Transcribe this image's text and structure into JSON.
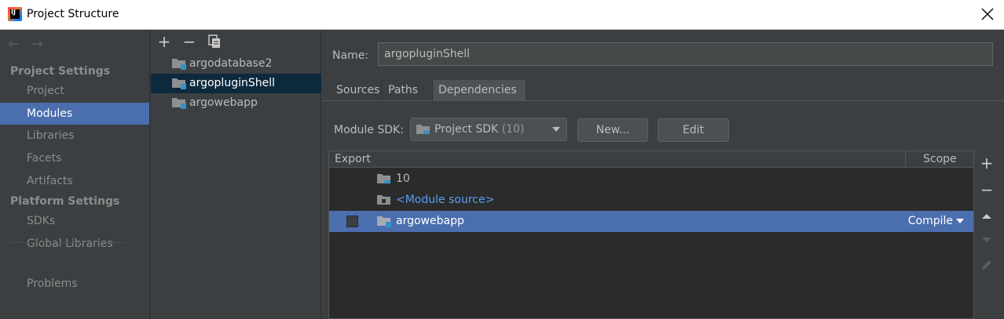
{
  "window": {
    "title": "Project Structure",
    "close_icon": "close-icon"
  },
  "nav": {
    "back_icon": "arrow-left-icon",
    "forward_icon": "arrow-right-icon",
    "project_settings_title": "Project Settings",
    "platform_settings_title": "Platform Settings",
    "items": {
      "project": "Project",
      "modules": "Modules",
      "libraries": "Libraries",
      "facets": "Facets",
      "artifacts": "Artifacts",
      "sdks": "SDKs",
      "global_libraries": "Global Libraries",
      "problems": "Problems"
    },
    "selected": "Modules"
  },
  "module_tree": {
    "toolbar": {
      "add": "+",
      "remove": "−",
      "copy_icon": "copy-icon"
    },
    "modules": [
      "argodatabase2",
      "argopluginShell",
      "argowebapp"
    ],
    "selected": "argopluginShell"
  },
  "module_detail": {
    "name_label": "Name:",
    "name_value": "argopluginShell",
    "tabs": [
      "Sources",
      "Paths",
      "Dependencies"
    ],
    "active_tab": "Dependencies",
    "sdk_label": "Module SDK:",
    "sdk_value": "Project SDK",
    "sdk_version": "(10)",
    "new_button": "New...",
    "edit_button": "Edit",
    "table": {
      "col_export": "Export",
      "col_scope": "Scope",
      "rows": [
        {
          "name": "10",
          "type": "sdk",
          "scope": ""
        },
        {
          "name": "<Module source>",
          "type": "source",
          "scope": ""
        },
        {
          "name": "argowebapp",
          "type": "module",
          "scope": "Compile",
          "exported": false
        }
      ]
    },
    "side_tools": [
      "add-icon",
      "remove-icon",
      "move-up-icon",
      "move-down-icon",
      "edit-pencil-icon"
    ]
  },
  "colors": {
    "accent": "#4b6eaf",
    "selection_dark": "#0d293e",
    "link": "#589df6",
    "module_blue": "#3592c4"
  }
}
